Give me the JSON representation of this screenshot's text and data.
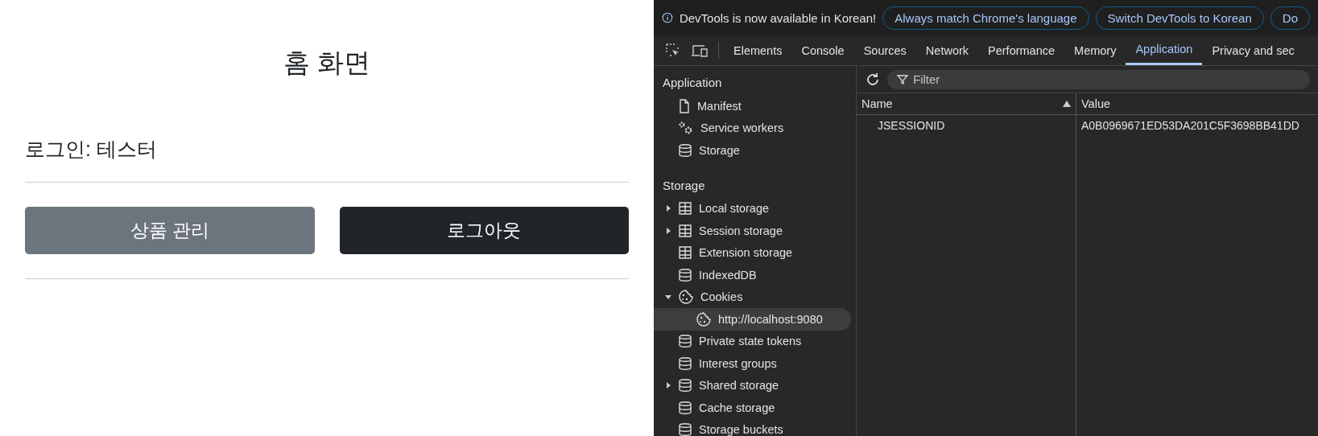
{
  "page": {
    "title": "홈 화면",
    "login_text": "로그인: 테스터",
    "buttons": [
      {
        "label": "상품 관리",
        "kind": "secondary"
      },
      {
        "label": "로그아웃",
        "kind": "dark"
      }
    ]
  },
  "devtools": {
    "infobar": {
      "message": "DevTools is now available in Korean!",
      "buttons": [
        "Always match Chrome's language",
        "Switch DevTools to Korean",
        "Do"
      ]
    },
    "tabs": [
      {
        "label": "Elements",
        "selected": false
      },
      {
        "label": "Console",
        "selected": false
      },
      {
        "label": "Sources",
        "selected": false
      },
      {
        "label": "Network",
        "selected": false
      },
      {
        "label": "Performance",
        "selected": false
      },
      {
        "label": "Memory",
        "selected": false
      },
      {
        "label": "Application",
        "selected": true
      },
      {
        "label": "Privacy and sec",
        "selected": false
      }
    ],
    "sidebar": [
      {
        "heading": "Application",
        "items": [
          {
            "label": "Manifest",
            "kind": "file",
            "selected": false
          },
          {
            "label": "Service workers",
            "kind": "gears",
            "selected": false
          },
          {
            "label": "Storage",
            "kind": "database",
            "selected": false
          }
        ]
      },
      {
        "heading": "Storage",
        "items": [
          {
            "label": "Local storage",
            "kind": "table",
            "expanded": false,
            "selected": false
          },
          {
            "label": "Session storage",
            "kind": "table",
            "expanded": false,
            "selected": false
          },
          {
            "label": "Extension storage",
            "kind": "table",
            "selected": false
          },
          {
            "label": "IndexedDB",
            "kind": "database",
            "selected": false
          },
          {
            "label": "Cookies",
            "kind": "cookie",
            "expanded": true,
            "selected": false,
            "children": [
              {
                "label": "http://localhost:9080",
                "kind": "cookie",
                "selected": true
              }
            ]
          },
          {
            "label": "Private state tokens",
            "kind": "database",
            "selected": false
          },
          {
            "label": "Interest groups",
            "kind": "database",
            "selected": false
          },
          {
            "label": "Shared storage",
            "kind": "database",
            "expanded": false,
            "selected": false
          },
          {
            "label": "Cache storage",
            "kind": "database",
            "selected": false
          },
          {
            "label": "Storage buckets",
            "kind": "database",
            "selected": false
          }
        ]
      }
    ],
    "filter": {
      "placeholder": "Filter"
    },
    "table": {
      "columns": [
        "Name",
        "Value"
      ],
      "rows": [
        [
          "JSESSIONID",
          "A0B0969671ED53DA201C5F3698BB41DD"
        ]
      ]
    }
  }
}
